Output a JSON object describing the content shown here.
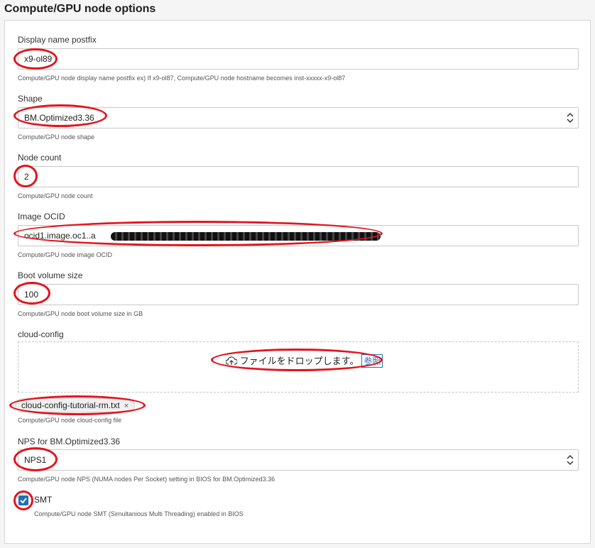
{
  "section": {
    "title": "Compute/GPU node options"
  },
  "display_name": {
    "label": "Display name postfix",
    "value": "x9-ol89",
    "help": "Compute/GPU node display name postfix ex) If x9-ol87, Compute/GPU node hostname becomes inst-xxxxx-x9-ol87"
  },
  "shape": {
    "label": "Shape",
    "value": "BM.Optimized3.36",
    "help": "Compute/GPU node shape"
  },
  "node_count": {
    "label": "Node count",
    "value": "2",
    "help": "Compute/GPU node count"
  },
  "image_ocid": {
    "label": "Image OCID",
    "value": "ocid1.image.oc1..a",
    "help": "Compute/GPU node image OCID"
  },
  "boot_volume": {
    "label": "Boot volume size",
    "value": "100",
    "help": "Compute/GPU node boot volume size in GB"
  },
  "cloud_config": {
    "label": "cloud-config",
    "drop_text": "ファイルをドロップします。",
    "browse_label": "参照",
    "file_name": "cloud-config-tutorial-rm.txt",
    "remove_glyph": "×",
    "help": "Compute/GPU node cloud-config file"
  },
  "nps": {
    "label": "NPS for BM.Optimized3.36",
    "value": "NPS1",
    "help": "Compute/GPU node NPS (NUMA nodes Per Socket) setting in BIOS for BM.Optimized3.36"
  },
  "smt": {
    "label": "SMT",
    "checked": true,
    "help": "Compute/GPU node SMT (Simultanious Multi Threading) enabled in BIOS"
  },
  "colors": {
    "annotation": "#e3141e",
    "checkbox": "#1f6fb6"
  }
}
